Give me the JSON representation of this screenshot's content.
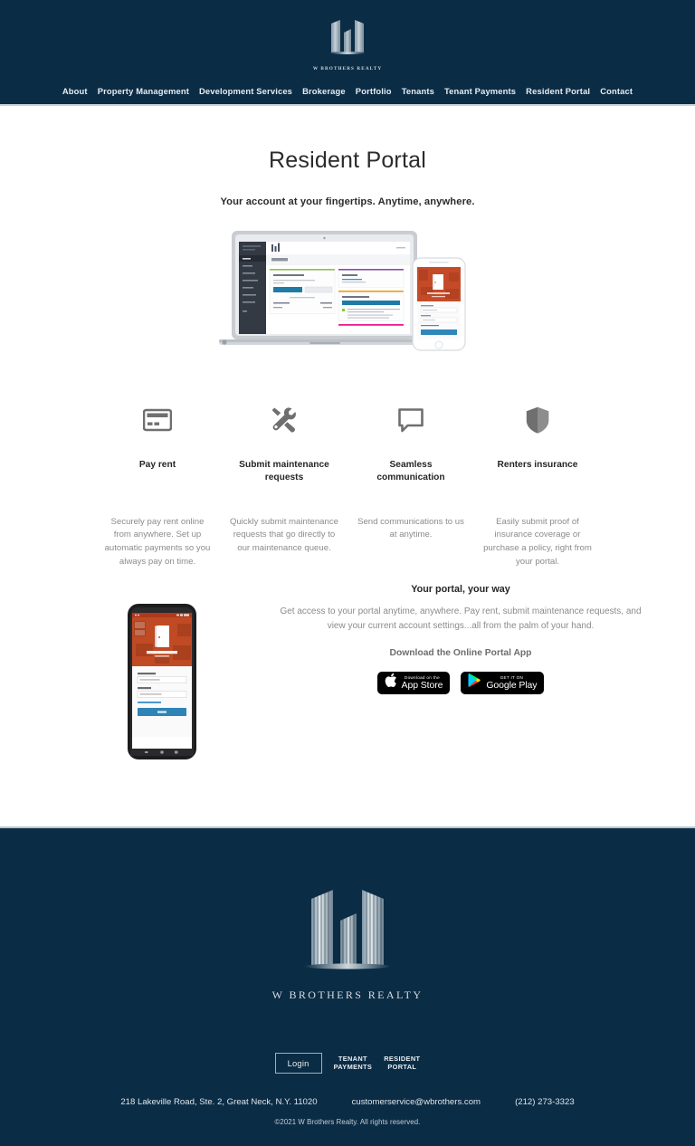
{
  "brand": {
    "name": "W BROTHERS REALTY",
    "logo_icon": "three-towers-logo",
    "navy": "#0b2c45",
    "logo_light": "#d6dde2"
  },
  "nav": {
    "items": [
      {
        "label": "About"
      },
      {
        "label": "Property Management"
      },
      {
        "label": "Development Services"
      },
      {
        "label": "Brokerage"
      },
      {
        "label": "Portfolio"
      },
      {
        "label": "Tenants"
      },
      {
        "label": "Tenant Payments"
      },
      {
        "label": "Resident Portal"
      },
      {
        "label": "Contact"
      }
    ]
  },
  "hero": {
    "title": "Resident Portal",
    "subtitle": "Your account at your fingertips. Anytime, anywhere.",
    "mockup_alt": "laptop-and-phone-portal-screens"
  },
  "features": [
    {
      "icon": "credit-card-icon",
      "label": "Pay rent",
      "desc": "Securely pay rent online from anywhere. Set up automatic payments so you always pay on time."
    },
    {
      "icon": "tools-icon",
      "label": "Submit maintenance requests",
      "desc": "Quickly submit maintenance requests that go directly to our maintenance queue."
    },
    {
      "icon": "chat-bubble-icon",
      "label": "Seamless communication",
      "desc": "Send communications to us at anytime."
    },
    {
      "icon": "shield-icon",
      "label": "Renters insurance",
      "desc": "Easily submit proof of insurance coverage or purchase a policy, right from your portal."
    }
  ],
  "portal": {
    "heading": "Your portal, your way",
    "body": "Get access to your portal anytime, anywhere. Pay rent, submit maintenance requests, and view your current account settings...all from the palm of your hand.",
    "download_label": "Download the Online Portal App",
    "phone_mockup_alt": "android-phone-online-portal-login",
    "phone_screen": {
      "app_title": "Online Portal",
      "app_subtitle": "by appfolio",
      "email_label": "Email address",
      "email_placeholder": "example@email.com",
      "password_label": "Password",
      "password_placeholder": "Enter your password",
      "forgot_link": "Forgot your password?",
      "login_button": "Login"
    },
    "badges": [
      {
        "icon": "apple-icon",
        "small": "Download on the",
        "big": "App Store"
      },
      {
        "icon": "google-play-icon",
        "small": "GET IT ON",
        "big": "Google Play"
      }
    ]
  },
  "footer": {
    "logo_icon": "three-towers-logo",
    "brand_word": "W BROTHERS REALTY",
    "login_label": "Login",
    "links": [
      {
        "line1": "TENANT",
        "line2": "PAYMENTS"
      },
      {
        "line1": "RESIDENT",
        "line2": "PORTAL"
      }
    ],
    "address": "218 Lakeville Road, Ste. 2, Great Neck, N.Y. 11020",
    "email": "customerservice@wbrothers.com",
    "phone": "(212) 273-3323",
    "copyright": "©2021 W Brothers Realty. All rights reserved."
  }
}
